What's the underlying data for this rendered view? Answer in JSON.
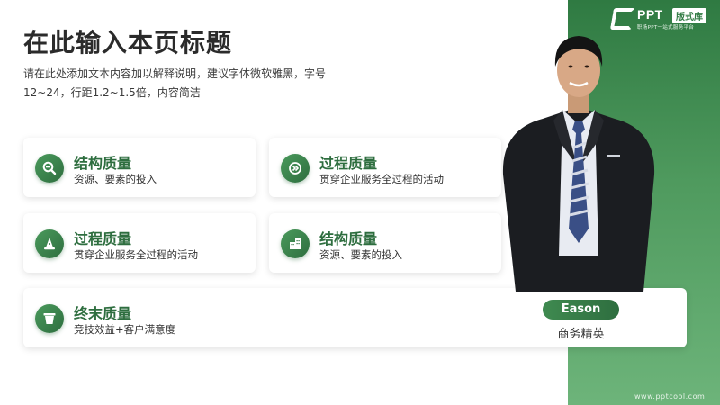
{
  "page": {
    "title": "在此输入本页标题",
    "intro_line1": "请在此处添加文本内容加以解释说明，建议字体微软雅黑，字号",
    "intro_line2": "12~24，行距1.2~1.5倍，内容简洁"
  },
  "logo": {
    "text": "PPT",
    "badge": "版式库",
    "subtitle": "职场PPT一站式服务平台"
  },
  "cards": [
    {
      "title": "结构质量",
      "desc": "资源、要素的投入",
      "icon": "search-icon"
    },
    {
      "title": "过程质量",
      "desc": "贯穿企业服务全过程的活动",
      "icon": "process-icon"
    },
    {
      "title": "过程质量",
      "desc": "贯穿企业服务全过程的活动",
      "icon": "wizard-hat-icon"
    },
    {
      "title": "结构质量",
      "desc": "资源、要素的投入",
      "icon": "building-icon"
    },
    {
      "title": "终末质量",
      "desc": "竞技效益+客户满意度",
      "icon": "bucket-icon"
    }
  ],
  "person": {
    "name": "Eason",
    "role": "商务精英"
  },
  "footer": {
    "url": "www.pptcool.com"
  },
  "colors": {
    "accent": "#2e6e3f",
    "panel_top": "#2f7a42",
    "panel_bottom": "#6db47a"
  }
}
